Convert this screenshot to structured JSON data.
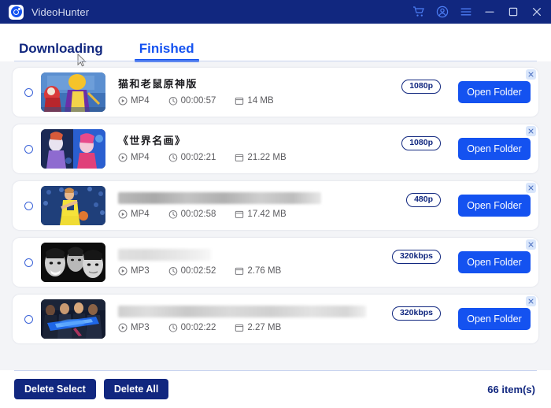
{
  "window": {
    "app_title": "VideoHunter",
    "logo_icon": "videohunter-logo-icon",
    "controls": [
      {
        "name": "cart-icon",
        "label": "Cart"
      },
      {
        "name": "account-icon",
        "label": "Account"
      },
      {
        "name": "menu-icon",
        "label": "Menu"
      },
      {
        "name": "minimize-icon",
        "label": "Minimize"
      },
      {
        "name": "maximize-icon",
        "label": "Maximize"
      },
      {
        "name": "close-icon",
        "label": "Close"
      }
    ],
    "titlebar_bg": "#11277f"
  },
  "tabs": [
    {
      "label": "Downloading",
      "active": false
    },
    {
      "label": "Finished",
      "active": true
    }
  ],
  "accent": {
    "primary_blue": "#1452f0",
    "navy": "#11277f",
    "list_bg": "#f3f4f7"
  },
  "list": {
    "items": [
      {
        "selected": false,
        "title": "猫和老鼠原神版",
        "title_blurred": false,
        "format": "MP4",
        "duration": "00:00:57",
        "size": "14 MB",
        "quality": "1080p",
        "action_label": "Open Folder"
      },
      {
        "selected": false,
        "title": "《世界名画》",
        "title_blurred": false,
        "format": "MP4",
        "duration": "00:02:21",
        "size": "21.22 MB",
        "quality": "1080p",
        "action_label": "Open Folder"
      },
      {
        "selected": false,
        "title": "",
        "title_blurred": true,
        "format": "MP4",
        "duration": "00:02:58",
        "size": "17.42 MB",
        "quality": "480p",
        "action_label": "Open Folder"
      },
      {
        "selected": false,
        "title": "",
        "title_blurred": true,
        "format": "MP3",
        "duration": "00:02:52",
        "size": "2.76 MB",
        "quality": "320kbps",
        "action_label": "Open Folder"
      },
      {
        "selected": false,
        "title": "",
        "title_blurred": true,
        "format": "MP3",
        "duration": "00:02:22",
        "size": "2.27 MB",
        "quality": "320kbps",
        "action_label": "Open Folder"
      }
    ]
  },
  "footer": {
    "delete_select_label": "Delete Select",
    "delete_all_label": "Delete All",
    "item_count": "66 item(s)"
  }
}
